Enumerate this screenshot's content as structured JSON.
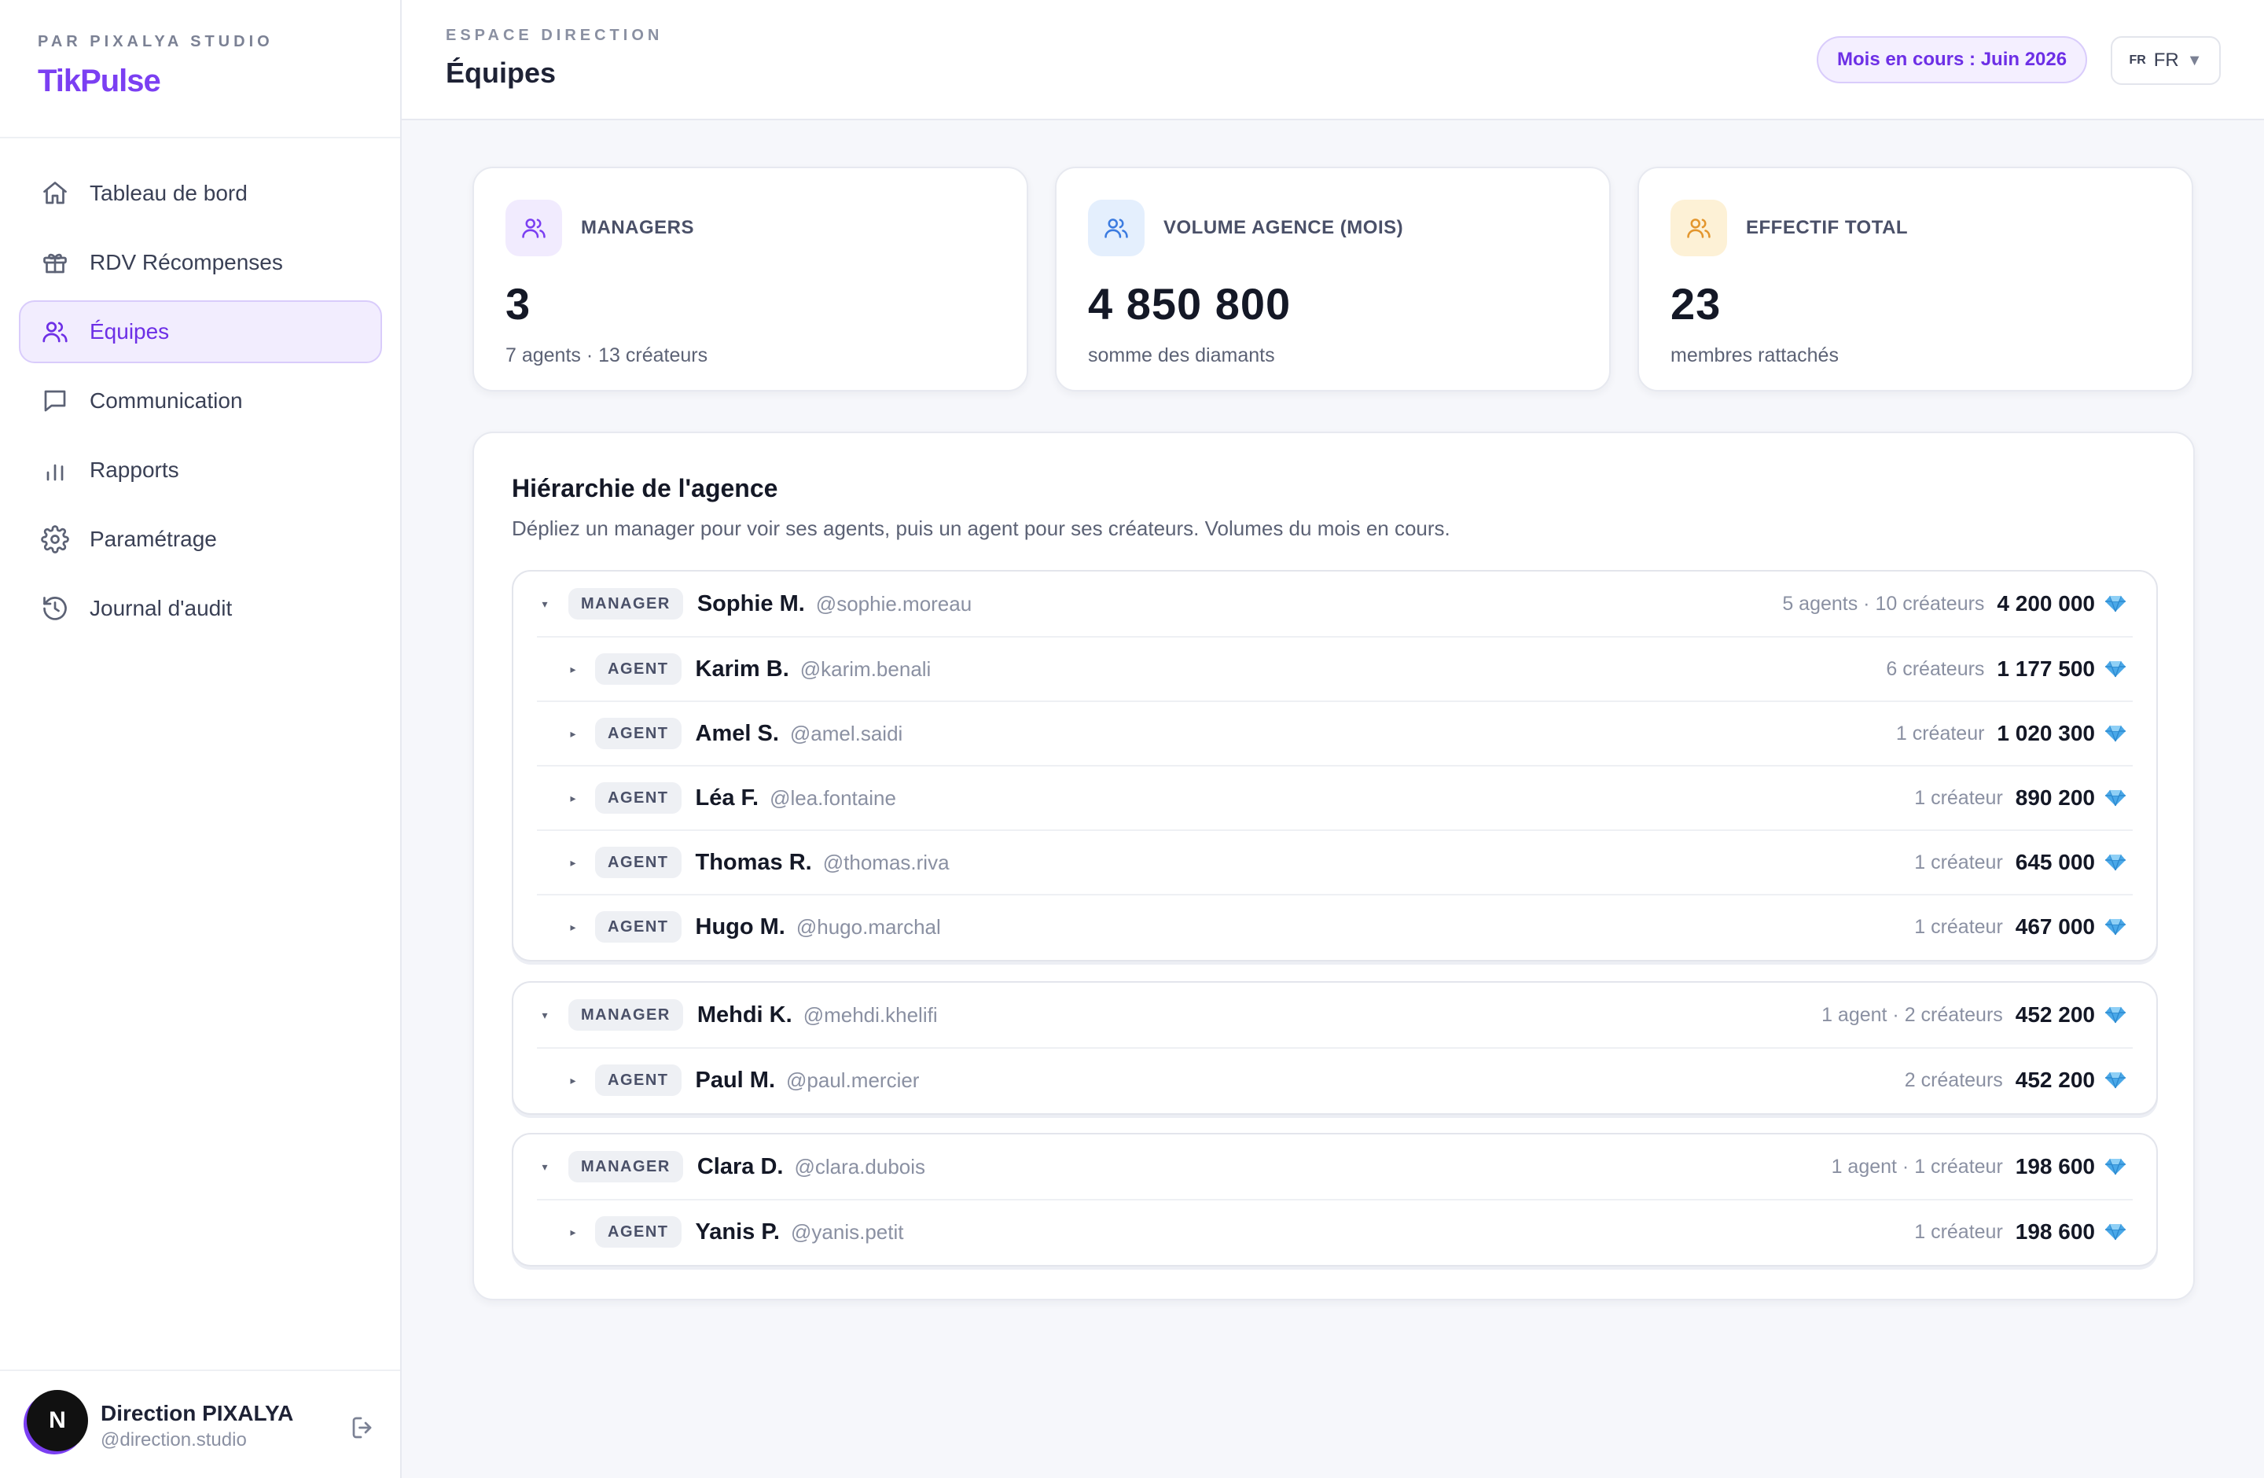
{
  "brand": {
    "sub": "PAR PIXALYA STUDIO",
    "name": "TikPulse"
  },
  "nav": [
    {
      "label": "Tableau de bord",
      "icon": "home-icon",
      "active": false
    },
    {
      "label": "RDV Récompenses",
      "icon": "gift-icon",
      "active": false
    },
    {
      "label": "Équipes",
      "icon": "users-icon",
      "active": true
    },
    {
      "label": "Communication",
      "icon": "message-icon",
      "active": false
    },
    {
      "label": "Rapports",
      "icon": "bar-chart-icon",
      "active": false
    },
    {
      "label": "Paramétrage",
      "icon": "gear-icon",
      "active": false
    },
    {
      "label": "Journal d'audit",
      "icon": "history-icon",
      "active": false
    }
  ],
  "user": {
    "initial": "N",
    "name": "Direction PIXALYA",
    "handle": "@direction.studio"
  },
  "header": {
    "sup": "ESPACE DIRECTION",
    "title": "Équipes",
    "month": "Mois en cours : Juin 2026",
    "lang_flag": "FR",
    "lang": "FR",
    "caret": "▼"
  },
  "stats": [
    {
      "label": "MANAGERS",
      "value": "3",
      "sub": "7 agents · 13 créateurs",
      "icon": "users-icon",
      "bg": "#f1ebfe",
      "color": "#7b3ff2"
    },
    {
      "label": "VOLUME AGENCE (MOIS)",
      "value": "4 850 800",
      "sub": "somme des diamants",
      "icon": "users-icon",
      "bg": "#e4effd",
      "color": "#3b7be0"
    },
    {
      "label": "EFFECTIF TOTAL",
      "value": "23",
      "sub": "membres rattachés",
      "icon": "users-icon",
      "bg": "#fdf1d6",
      "color": "#e3962d"
    }
  ],
  "hierarchy": {
    "title": "Hiérarchie de l'agence",
    "description": "Dépliez un manager pour voir ses agents, puis un agent pour ses créateurs. Volumes du mois en cours.",
    "groups": [
      {
        "manager": {
          "role": "MANAGER",
          "name": "Sophie M.",
          "handle": "@sophie.moreau",
          "meta": "5 agents · 10 créateurs",
          "volume": "4 200 000",
          "caret": "▾"
        },
        "agents": [
          {
            "role": "AGENT",
            "name": "Karim B.",
            "handle": "@karim.benali",
            "meta": "6 créateurs",
            "volume": "1 177 500",
            "caret": "▸"
          },
          {
            "role": "AGENT",
            "name": "Amel S.",
            "handle": "@amel.saidi",
            "meta": "1 créateur",
            "volume": "1 020 300",
            "caret": "▸"
          },
          {
            "role": "AGENT",
            "name": "Léa F.",
            "handle": "@lea.fontaine",
            "meta": "1 créateur",
            "volume": "890 200",
            "caret": "▸"
          },
          {
            "role": "AGENT",
            "name": "Thomas R.",
            "handle": "@thomas.riva",
            "meta": "1 créateur",
            "volume": "645 000",
            "caret": "▸"
          },
          {
            "role": "AGENT",
            "name": "Hugo M.",
            "handle": "@hugo.marchal",
            "meta": "1 créateur",
            "volume": "467 000",
            "caret": "▸"
          }
        ]
      },
      {
        "manager": {
          "role": "MANAGER",
          "name": "Mehdi K.",
          "handle": "@mehdi.khelifi",
          "meta": "1 agent · 2 créateurs",
          "volume": "452 200",
          "caret": "▾"
        },
        "agents": [
          {
            "role": "AGENT",
            "name": "Paul M.",
            "handle": "@paul.mercier",
            "meta": "2 créateurs",
            "volume": "452 200",
            "caret": "▸"
          }
        ]
      },
      {
        "manager": {
          "role": "MANAGER",
          "name": "Clara D.",
          "handle": "@clara.dubois",
          "meta": "1 agent · 1 créateur",
          "volume": "198 600",
          "caret": "▾"
        },
        "agents": [
          {
            "role": "AGENT",
            "name": "Yanis P.",
            "handle": "@yanis.petit",
            "meta": "1 créateur",
            "volume": "198 600",
            "caret": "▸"
          }
        ]
      }
    ]
  },
  "colors": {
    "accent": "#7b3ff2",
    "diamond": "#4aa8e8"
  }
}
